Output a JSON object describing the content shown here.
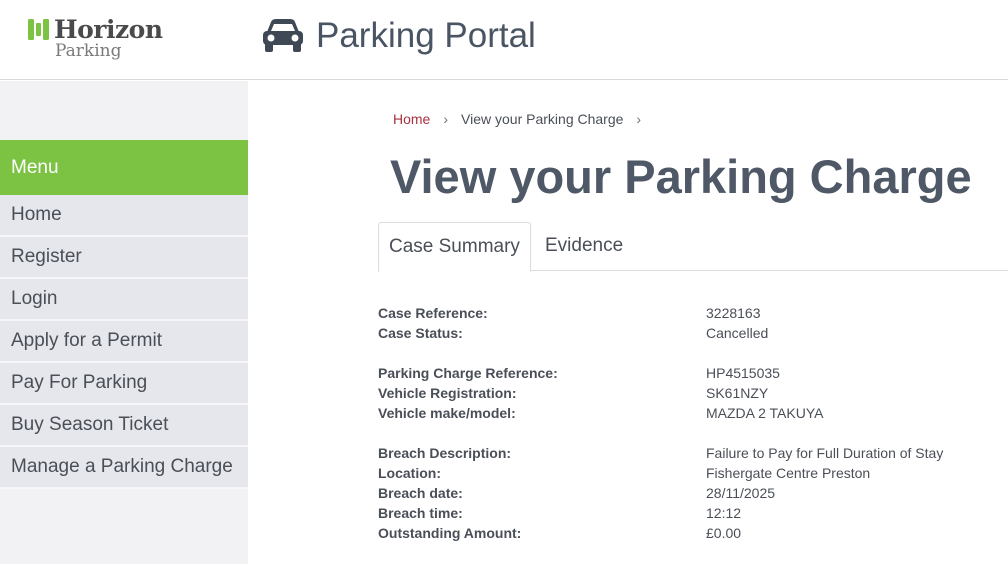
{
  "brand": {
    "word1": "Horizon",
    "word2": "Parking",
    "accent": "#7cc243"
  },
  "header": {
    "title": "Parking Portal",
    "icon": "car-icon"
  },
  "sidebar": {
    "menu_label": "Menu",
    "items": [
      {
        "label": "Home"
      },
      {
        "label": "Register"
      },
      {
        "label": "Login"
      },
      {
        "label": "Apply for a Permit"
      },
      {
        "label": "Pay For Parking"
      },
      {
        "label": "Buy Season Ticket"
      },
      {
        "label": "Manage a Parking Charge"
      }
    ]
  },
  "breadcrumb": {
    "home": "Home",
    "current": "View your Parking Charge",
    "separator": "›"
  },
  "page": {
    "title": "View your Parking Charge"
  },
  "tabs": [
    {
      "label": "Case Summary",
      "active": true
    },
    {
      "label": "Evidence",
      "active": false
    }
  ],
  "details": {
    "groups": [
      [
        {
          "label": "Case Reference:",
          "value": "3228163"
        },
        {
          "label": "Case Status:",
          "value": "Cancelled"
        }
      ],
      [
        {
          "label": "Parking Charge Reference:",
          "value": "HP4515035"
        },
        {
          "label": "Vehicle Registration:",
          "value": "SK61NZY"
        },
        {
          "label": "Vehicle make/model:",
          "value": "MAZDA 2 TAKUYA"
        }
      ],
      [
        {
          "label": "Breach Description:",
          "value": "Failure to Pay for Full Duration of Stay"
        },
        {
          "label": "Location:",
          "value": "Fishergate Centre Preston"
        },
        {
          "label": "Breach date:",
          "value": "28/11/2025"
        },
        {
          "label": "Breach time:",
          "value": "12:12"
        },
        {
          "label": "Outstanding Amount:",
          "value": "£0.00"
        }
      ]
    ]
  }
}
